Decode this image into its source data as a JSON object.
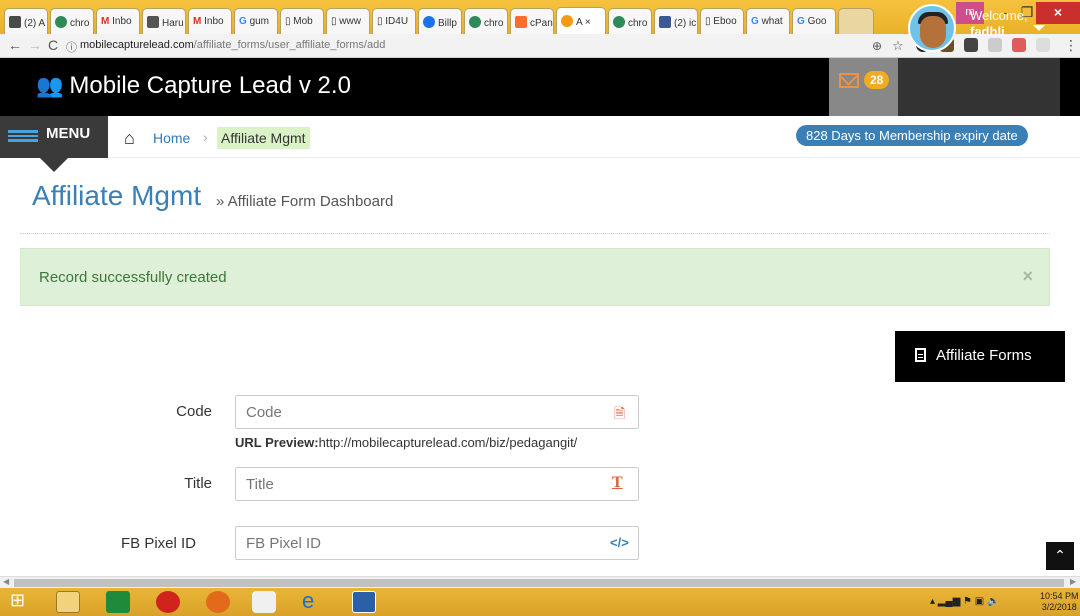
{
  "browser": {
    "tabs": [
      {
        "label": "(2) A",
        "color": "#4a4a4a"
      },
      {
        "label": "chro",
        "color": "#2e8b57"
      },
      {
        "label": "Inbo",
        "color": "#d93025"
      },
      {
        "label": "Haru",
        "color": "#555555"
      },
      {
        "label": "Inbo",
        "color": "#d93025"
      },
      {
        "label": "gum",
        "color": "#4285f4"
      },
      {
        "label": "Mob",
        "color": "#999999"
      },
      {
        "label": "www",
        "color": "#999999"
      },
      {
        "label": "ID4U",
        "color": "#999999"
      },
      {
        "label": "Billp",
        "color": "#1a73e8"
      },
      {
        "label": "chro",
        "color": "#2e8b57"
      },
      {
        "label": "cPan",
        "color": "#ff6c2c"
      },
      {
        "label": "A",
        "color": "#f39c12"
      },
      {
        "label": "chro",
        "color": "#2e8b57"
      },
      {
        "label": "(2) ic",
        "color": "#3b5998"
      },
      {
        "label": "Eboo",
        "color": "#999999"
      },
      {
        "label": "what",
        "color": "#4285f4"
      },
      {
        "label": "Goo",
        "color": "#4285f4"
      }
    ],
    "window_user": "m",
    "url_host": "mobilecapturelead.com",
    "url_path": "/affiliate_forms/user_affiliate_forms/add"
  },
  "header": {
    "brand": "Mobile Capture Lead v 2.0",
    "mail_count": "28",
    "welcome": "Welcome,",
    "username": "fadhli"
  },
  "breadcrumb": {
    "menu_label": "MENU",
    "home": "Home",
    "separator": "›",
    "current": "Affiliate Mgmt",
    "expiry": "828 Days to Membership expiry date"
  },
  "page": {
    "title": "Affiliate Mgmt",
    "subtitle": "» Affiliate Form Dashboard",
    "alert": "Record successfully created",
    "alert_close": "×",
    "affiliate_forms_button": "Affiliate Forms"
  },
  "form": {
    "code_label": "Code",
    "code_placeholder": "Code",
    "url_preview_label": "URL Preview:",
    "url_preview_value": "http://mobilecapturelead.com/biz/pedagangit/",
    "title_label": "Title",
    "title_placeholder": "Title",
    "fb_label": "FB Pixel ID",
    "fb_placeholder": "FB Pixel ID"
  },
  "taskbar": {
    "time": "10:54 PM",
    "date": "3/2/2018"
  }
}
